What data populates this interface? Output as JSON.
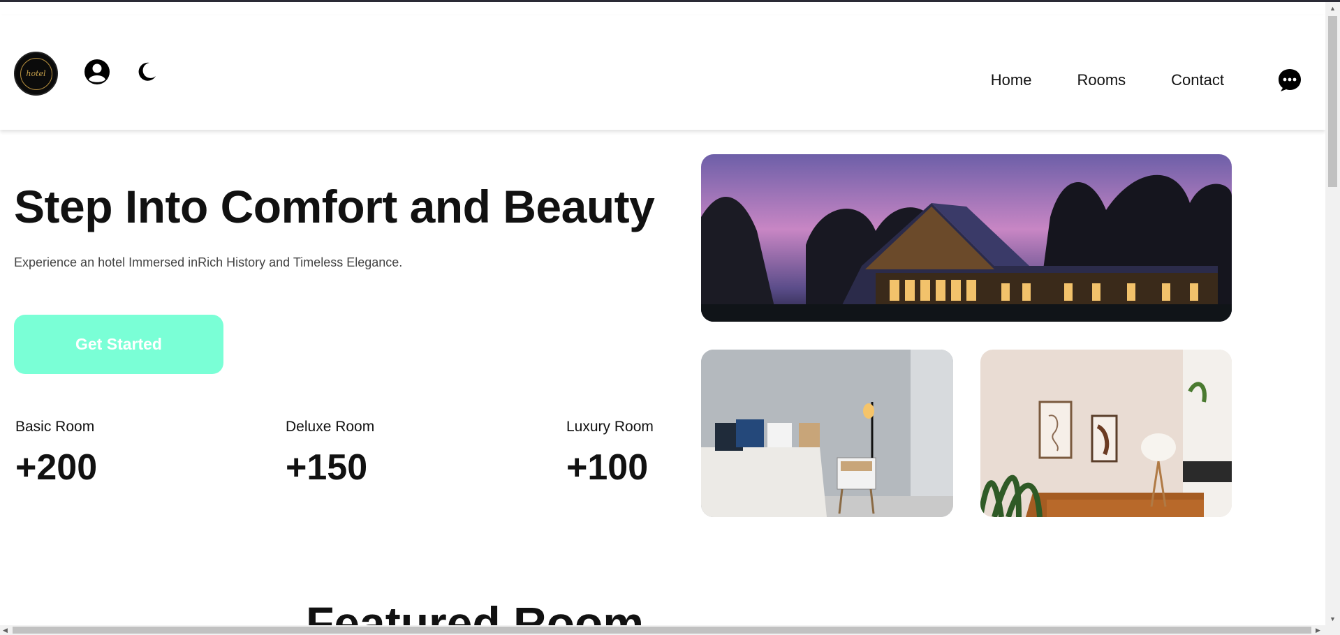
{
  "header": {
    "logo_text": "hotel",
    "nav": [
      "Home",
      "Rooms",
      "Contact"
    ]
  },
  "hero": {
    "title": "Step Into Comfort and Beauty",
    "subtitle": "Experience an hotel Immersed inRich History and Timeless Elegance.",
    "cta_label": "Get Started",
    "cta_color": "#7affd6"
  },
  "stats": [
    {
      "label": "Basic Room",
      "value": "+200"
    },
    {
      "label": "Deluxe Room",
      "value": "+150"
    },
    {
      "label": "Luxury Room",
      "value": "+100"
    }
  ],
  "section": {
    "title": "Featured Room"
  },
  "icons": [
    "user-icon",
    "moon-icon",
    "chat-icon"
  ]
}
